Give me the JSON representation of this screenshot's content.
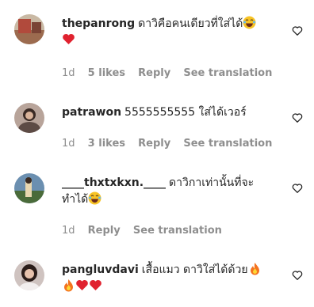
{
  "comments": [
    {
      "username": "thepanrong",
      "text": "ดาวิคือคนเดียวที่ใส่ได้",
      "emojis_line1": [
        "laughing-tears-emoji"
      ],
      "emojis_line2": [
        "red-heart-emoji"
      ],
      "time": "1d",
      "likes": "5 likes",
      "reply": "Reply",
      "see_translation": "See translation"
    },
    {
      "username": "patrawon",
      "text": "5555555555 ใส่ได้เวอร์",
      "time": "1d",
      "likes": "3 likes",
      "reply": "Reply",
      "see_translation": "See translation"
    },
    {
      "username": "____thxtxkxn.____",
      "text": "ดาวิกาเท่านั้นที่จะ",
      "text_line2": "ทำได้",
      "emojis_line2": [
        "laughing-tears-emoji"
      ],
      "time": "1d",
      "reply": "Reply",
      "see_translation": "See translation"
    },
    {
      "username": "pangluvdavi",
      "text": "เสื้อแมว ดาวิใส่ได้ด้วย",
      "emojis_line1": [
        "fire-emoji"
      ],
      "emojis_line2": [
        "fire-emoji",
        "red-heart-emoji",
        "red-heart-emoji"
      ]
    }
  ],
  "colors": {
    "text": "#262626",
    "meta": "#8e8e8e",
    "heart_red": "#ed4956"
  }
}
